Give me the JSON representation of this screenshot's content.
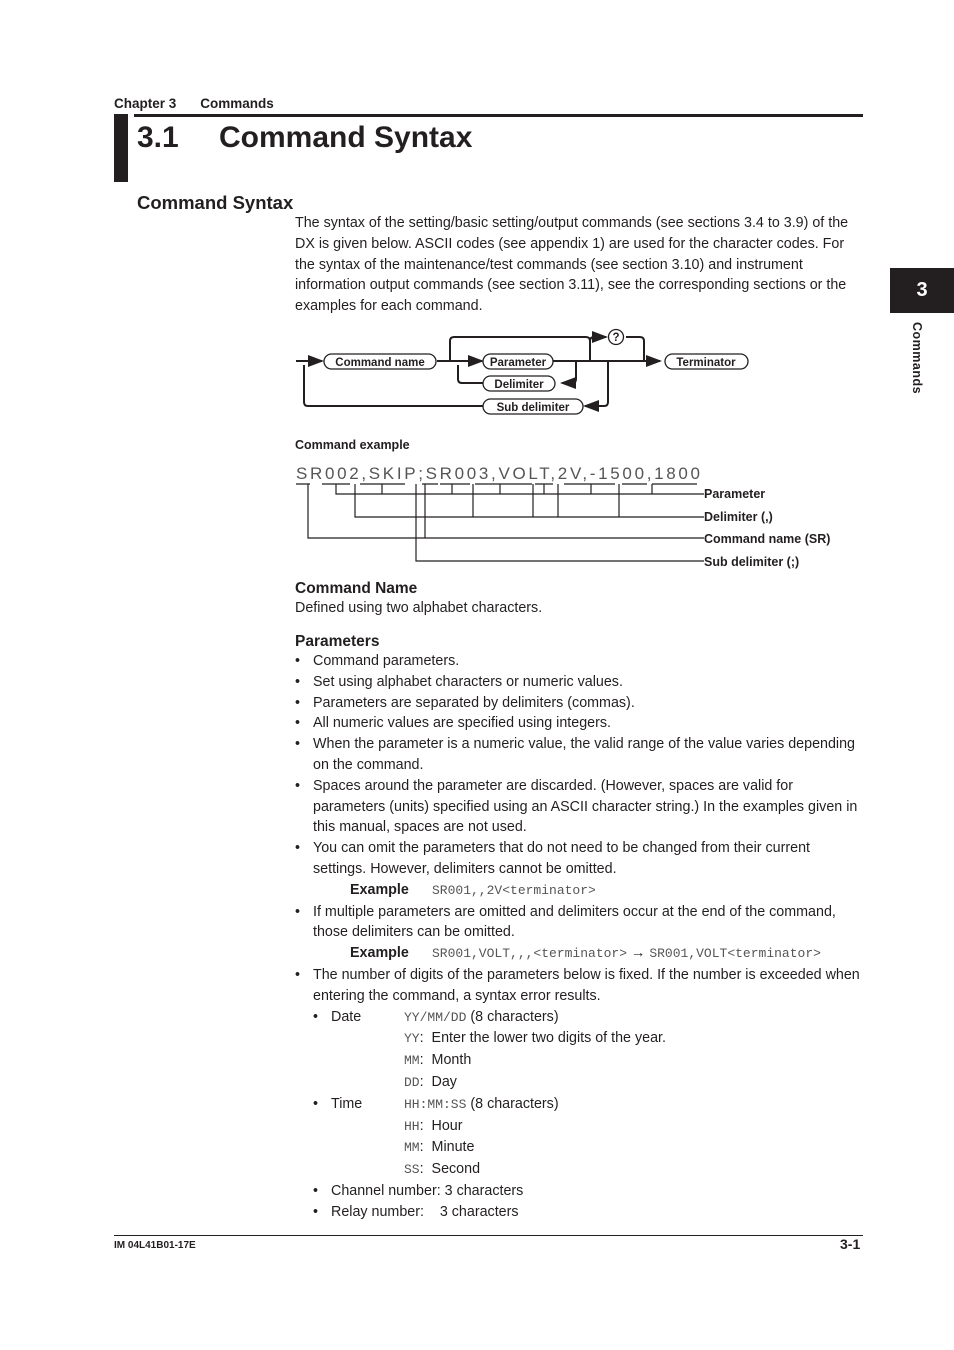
{
  "header": {
    "chapter": "Chapter 3",
    "chapter_title": "Commands"
  },
  "section": {
    "number": "3.1",
    "title": "Command Syntax"
  },
  "subsection": {
    "title": "Command Syntax"
  },
  "intro": "The syntax of the setting/basic setting/output commands (see sections 3.4 to 3.9) of the DX is given below. ASCII codes (see appendix 1) are used for the character codes. For the syntax of the maintenance/test commands (see section 3.10) and instrument information output commands (see section 3.11), see the corresponding sections or the examples for each command.",
  "side_tab": {
    "number": "3",
    "label": "Commands"
  },
  "syntax_diagram": {
    "command_name": "Command name",
    "parameter": "Parameter",
    "delimiter": "Delimiter",
    "sub_delimiter": "Sub delimiter",
    "query": "?",
    "terminator": "Terminator"
  },
  "command_example": {
    "label": "Command example",
    "text": "SR002,SKIP;SR003,VOLT,2V,-1500,1800",
    "annotations": [
      "Parameter",
      "Delimiter (,)",
      "Command name (SR)",
      "Sub delimiter (;)"
    ]
  },
  "command_name_section": {
    "title": "Command Name",
    "text": "Defined using two alphabet characters."
  },
  "parameters_section": {
    "title": "Parameters",
    "items": [
      "Command parameters.",
      "Set using alphabet characters or numeric values.",
      "Parameters are separated by delimiters (commas).",
      "All numeric values are specified using integers.",
      "When the parameter is a numeric value, the valid range of the value varies depending on the command.",
      "Spaces around the parameter are discarded. (However, spaces are valid for parameters (units) specified using an ASCII character string.)  In the examples given in this manual, spaces are not used.",
      "You can omit the parameters that do not need to be changed from their current settings. However, delimiters cannot be omitted.",
      "If multiple parameters are omitted and delimiters occur at the end of the command, those delimiters can be omitted.",
      "The number of digits of the parameters below is fixed. If the number is exceeded when entering the command, a syntax error results."
    ],
    "example_label": "Example",
    "example1": "SR001,,2V<terminator>",
    "example2_from": "SR001,VOLT,,,<terminator>",
    "arrow": "→",
    "example2_to": "SR001,VOLT<terminator>",
    "fixed": {
      "date_label": "Date",
      "date_format": "YY/MM/DD",
      "date_chars": " (8 characters)",
      "date_parts": [
        {
          "code": "YY",
          "desc": "Enter the lower two digits of the year."
        },
        {
          "code": "MM",
          "desc": "Month"
        },
        {
          "code": "DD",
          "desc": "Day"
        }
      ],
      "time_label": "Time",
      "time_format": "HH:MM:SS",
      "time_chars": " (8 characters)",
      "time_parts": [
        {
          "code": "HH",
          "desc": "Hour"
        },
        {
          "code": "MM",
          "desc": "Minute"
        },
        {
          "code": "SS",
          "desc": "Second"
        }
      ],
      "channel": "Channel number: 3 characters",
      "relay": "Relay number:    3 characters"
    }
  },
  "footer": {
    "doc_id": "IM 04L41B01-17E",
    "page": "3-1"
  }
}
